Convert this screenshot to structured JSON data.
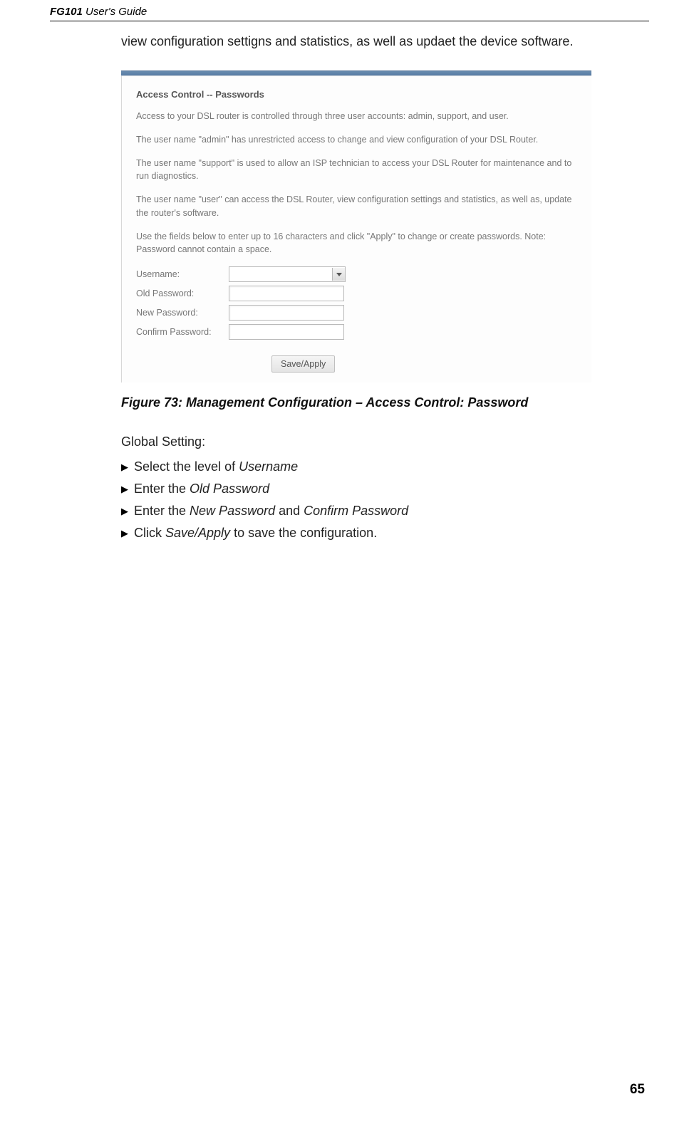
{
  "header": {
    "product": "FG101",
    "subtitle": "User's Guide"
  },
  "intro": "view configuration settigns and statistics, as well as updaet the device software.",
  "figure": {
    "heading": "Access Control -- Passwords",
    "p1": "Access to your DSL router is controlled through three user accounts: admin, support, and user.",
    "p2": "The user name \"admin\" has unrestricted access to change and view configuration of your DSL Router.",
    "p3": "The user name \"support\" is used to allow an ISP technician to access your DSL Router for maintenance and to run diagnostics.",
    "p4": "The user name \"user\" can access the DSL Router, view configuration settings and statistics, as well as, update the router's software.",
    "p5": "Use the fields below to enter up to 16 characters and click \"Apply\" to change or create passwords. Note: Password cannot contain a space.",
    "labels": {
      "username": "Username:",
      "oldpw": "Old Password:",
      "newpw": "New Password:",
      "confirm": "Confirm Password:"
    },
    "apply": "Save/Apply"
  },
  "caption": "Figure 73: Management Configuration – Access Control: Password",
  "global": {
    "title": "Global Setting:",
    "b1a": "Select the level of ",
    "b1b": "Username",
    "b2a": "Enter the ",
    "b2b": "Old Password",
    "b3a": "Enter the ",
    "b3b": "New Password",
    "b3c": " and ",
    "b3d": "Confirm Password",
    "b4a": "Click ",
    "b4b": "Save/Apply",
    "b4c": " to save the configuration."
  },
  "pagenum": "65"
}
